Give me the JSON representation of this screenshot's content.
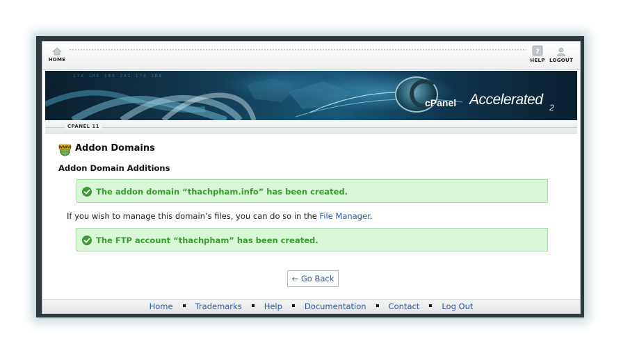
{
  "topbar": {
    "home_label": "HOME",
    "help_label": "HELP",
    "logout_label": "LOGOUT"
  },
  "banner": {
    "logo_name": "cPanel",
    "logo_tagline": "Accelerated",
    "logo_version": "2",
    "binary_text": "1?X  1RX  1RX  2X1  1?X  1RX"
  },
  "version_label": "CPANEL 11",
  "page": {
    "title": "Addon Domains",
    "title_icon": "www-globe-icon",
    "subtitle": "Addon Domain Additions"
  },
  "messages": {
    "domain_created": "The addon domain “thachpham.info” has been created.",
    "ftp_created": "The FTP account “thachpham” has been created.",
    "icon": "success-check-icon"
  },
  "info": {
    "text": "If you wish to manage this domain’s files, you can do so in the",
    "link": "File Manager",
    "end": "."
  },
  "go_back_label": "← Go Back",
  "footer": {
    "links": [
      "Home",
      "Trademarks",
      "Help",
      "Documentation",
      "Contact",
      "Log Out"
    ]
  },
  "colors": {
    "success_bg": "#d8f7d6",
    "success_border": "#a6e0a1",
    "success_text": "#3c9a32",
    "link": "#2b5aa0"
  }
}
